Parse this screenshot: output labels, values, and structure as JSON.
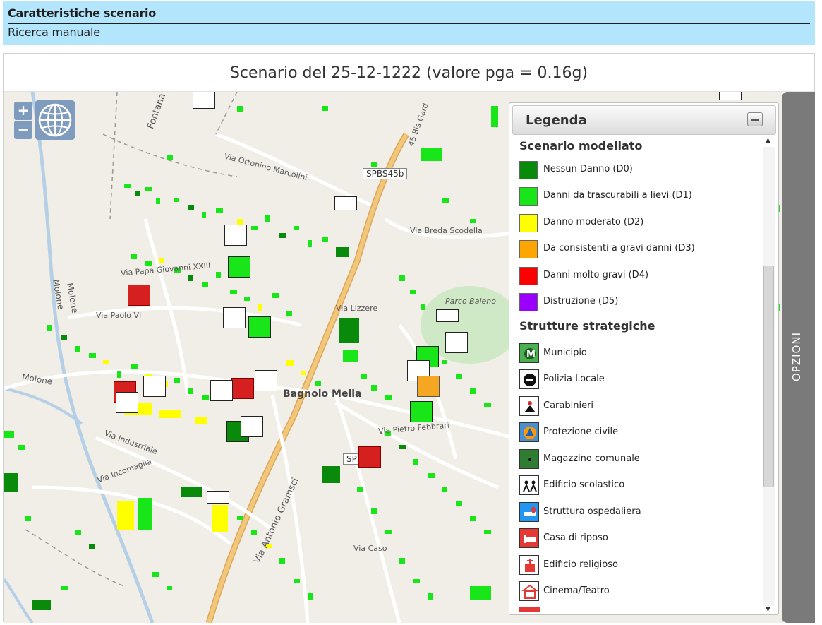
{
  "header": {
    "title": "Caratteristiche scenario",
    "subtitle": "Ricerca manuale"
  },
  "scenario": {
    "title": "Scenario del 25-12-1222 (valore pga = 0.16g)"
  },
  "map": {
    "zoom_in": "+",
    "zoom_out": "−",
    "labels": {
      "fontana": "Fontana",
      "molone1": "Molone",
      "molone2": "Molone",
      "molone3": "Molone",
      "via_ottonino": "Via Ottonino Marcolini",
      "via_papa": "Via Papa Giovanni XXIII",
      "via_paolo": "Via Paolo VI",
      "via_breda": "Via Breda Scodella",
      "parco": "Parco Baleno",
      "via_lizzere": "Via Lizzere",
      "bagnolo": "Bagnolo Mella",
      "via_febbrari": "Via Pietro Febbrari",
      "via_gramsci": "Via Antonio Gramsci",
      "via_incomaglia": "Via Incomaglia",
      "via_industriale": "Via Industriale",
      "via_caso": "Via Caso",
      "bis_gard": "45 Bis Gard",
      "road_spbs": "SPBS45b",
      "road_sp": "SP"
    }
  },
  "legend": {
    "title": "Legenda",
    "section_scenario": "Scenario modellato",
    "damage": [
      {
        "label": "Nessun Danno (D0)",
        "color": "#0a8a0a"
      },
      {
        "label": "Danni da trascurabili a lievi (D1)",
        "color": "#19e619"
      },
      {
        "label": "Danno moderato (D2)",
        "color": "#ffff00"
      },
      {
        "label": "Da consistenti a gravi danni (D3)",
        "color": "#ffa500"
      },
      {
        "label": "Danni molto gravi (D4)",
        "color": "#ff0000"
      },
      {
        "label": "Distruzione (D5)",
        "color": "#9b00ff"
      }
    ],
    "section_strutture": "Strutture strategiche",
    "strutture": [
      {
        "label": "Municipio",
        "icon": "municipio-icon"
      },
      {
        "label": "Polizia Locale",
        "icon": "police-icon"
      },
      {
        "label": "Carabinieri",
        "icon": "carabinieri-icon"
      },
      {
        "label": "Protezione civile",
        "icon": "civil-protection-icon"
      },
      {
        "label": "Magazzino comunale",
        "icon": "warehouse-icon"
      },
      {
        "label": "Edificio scolastico",
        "icon": "school-icon"
      },
      {
        "label": "Struttura ospedaliera",
        "icon": "hospital-icon"
      },
      {
        "label": "Casa di riposo",
        "icon": "nursing-home-icon"
      },
      {
        "label": "Edificio religioso",
        "icon": "church-icon"
      },
      {
        "label": "Cinema/Teatro",
        "icon": "theatre-icon"
      }
    ]
  },
  "options": {
    "label": "OPZIONI"
  }
}
